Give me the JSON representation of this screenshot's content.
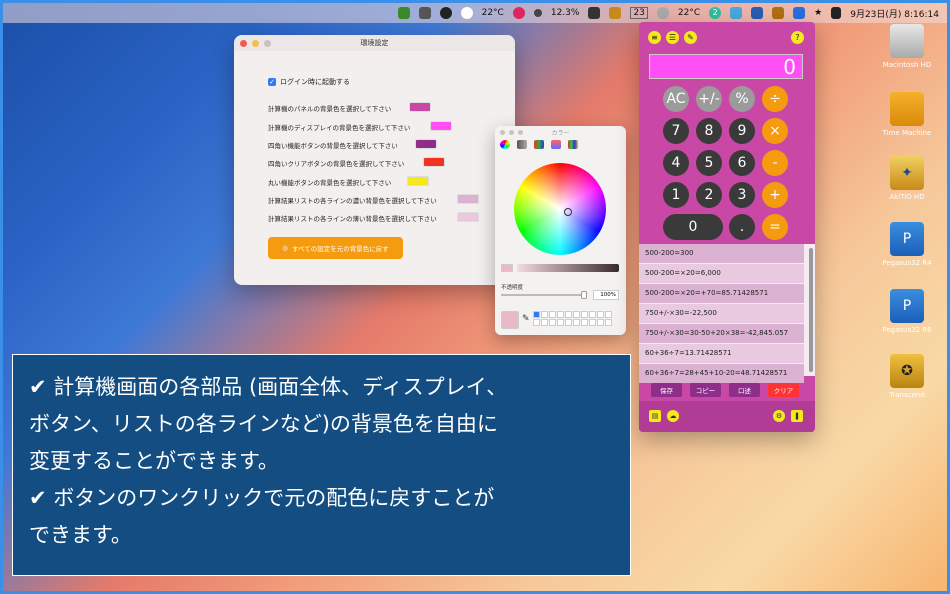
{
  "menubar": {
    "weather1": "22°C",
    "cpu": "12.3%",
    "calendar_day": "23",
    "weather2": "22°C",
    "badge_num": "2",
    "datetime": "9月23日(月)  8:16:14"
  },
  "settings_window": {
    "title": "環境設定",
    "login_label": "ログイン時に起動する",
    "rows": [
      {
        "label": "計算機のパネルの背景色を選択して下さい",
        "color": "#c948a6"
      },
      {
        "label": "計算機のディスプレイの背景色を選択して下さい",
        "color": "#ff4ff5"
      },
      {
        "label": "四角い機能ボタンの背景色を選択して下さい",
        "color": "#8e2d8a"
      },
      {
        "label": "四角いクリアボタンの背景色を選択して下さい",
        "color": "#f3321f"
      },
      {
        "label": "丸い機能ボタンの背景色を選択して下さい",
        "color": "#f5e81f"
      },
      {
        "label": "計算結果リストの各ラインの濃い背景色を選択して下さい",
        "color": "#dcb2d3"
      },
      {
        "label": "計算結果リストの各ラインの薄い背景色を選択して下さい",
        "color": "#e8c9e0"
      }
    ],
    "reset_label": "すべての設定を元の背景色に戻す"
  },
  "color_panel": {
    "title": "カラー",
    "opacity_label": "不透明度",
    "opacity_value": "100%"
  },
  "calculator": {
    "display": "0",
    "keys": {
      "ac": "AC",
      "sign": "+/-",
      "percent": "%",
      "divide": "÷",
      "n7": "7",
      "n8": "8",
      "n9": "9",
      "multiply": "×",
      "n4": "4",
      "n5": "5",
      "n6": "6",
      "minus": "-",
      "n1": "1",
      "n2": "2",
      "n3": "3",
      "plus": "+",
      "n0": "0",
      "dot": ".",
      "equals": "="
    },
    "history": [
      "500-200=300",
      "500-200=×20=6,000",
      "500-200=×20=+70=85.71428571",
      "750+/-×30=-22,500",
      "750+/-×30=30-50+20×38=-42,845.057",
      "60+36÷7=13.71428571",
      "60+36÷7=28+45+10-20=48.71428571"
    ],
    "actions": {
      "save": "保存",
      "copy": "コピー",
      "history": "口述",
      "clear": "クリア"
    },
    "help": "?"
  },
  "desktop_icons": [
    {
      "label": "Macintosh HD"
    },
    {
      "label": "Time Machine"
    },
    {
      "label": "AkiTiO HD"
    },
    {
      "label": "Pegasus32 R4"
    },
    {
      "label": "Pegasus32 R6"
    },
    {
      "label": "Transcend"
    }
  ],
  "caption": {
    "line1": "✔ 計算機画面の各部品 (画面全体、ディスプレイ、",
    "line2": "ボタン、リストの各ラインなど)の背景色を自由に",
    "line3": "変更することができます。",
    "line4": "✔ ボタンのワンクリックで元の配色に戻すことが",
    "line5": "できます。"
  }
}
